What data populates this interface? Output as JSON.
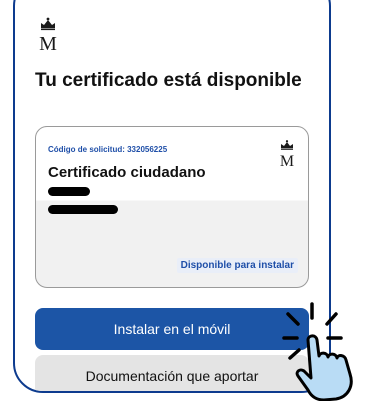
{
  "brand": {
    "logo_icon": "crown-m-logo-icon",
    "logo_letter": "M"
  },
  "page": {
    "title": "Tu certificado está disponible"
  },
  "certificate_card": {
    "request_code_label": "Código de solicitud: 332056225",
    "certificate_name": "Certificado ciudadano",
    "status_badge": "Disponible para instalar",
    "logo_icon": "crown-m-logo-icon",
    "redacted_lines": 2
  },
  "actions": {
    "install_label": "Instalar en el móvil",
    "documentation_label": "Documentación que aportar"
  },
  "overlay": {
    "tap_hand_icon": "tap-hand-icon"
  },
  "colors": {
    "primary_button": "#1c55a6",
    "secondary_button": "#e4e4e4",
    "accent_text": "#1f4fa8",
    "phone_frame": "#0d3b8e",
    "hand_fill": "#b9dcf5"
  }
}
